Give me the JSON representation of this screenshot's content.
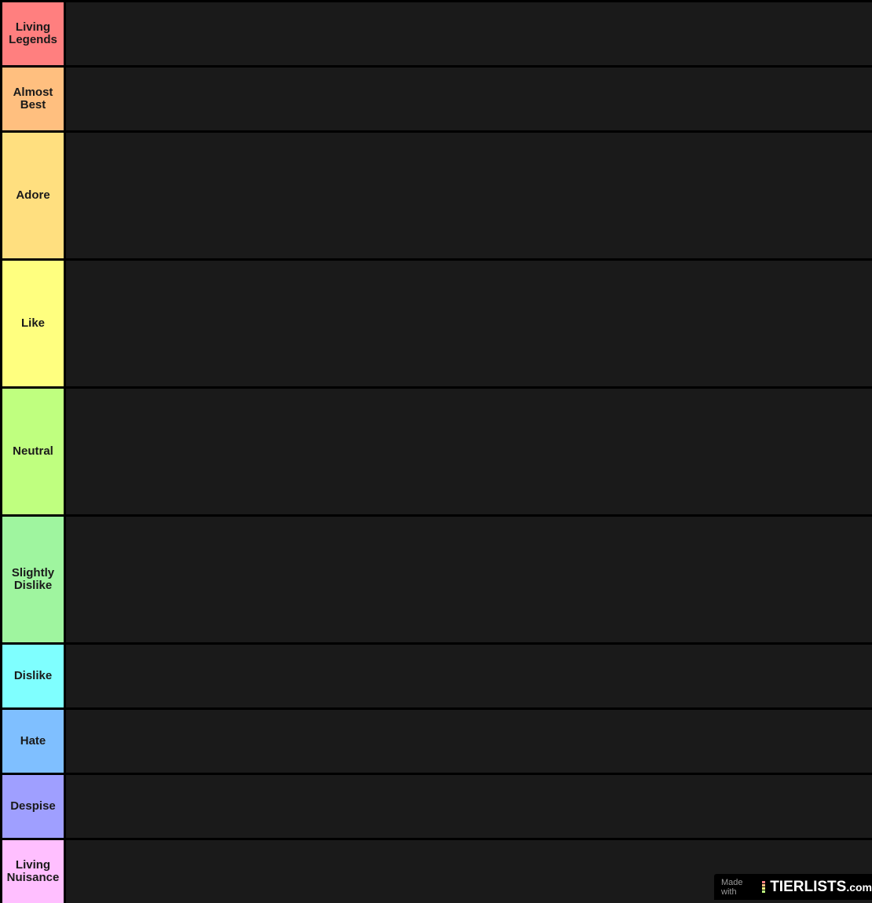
{
  "tiers": [
    {
      "label": "Living Legends",
      "color": "#ff7f7f"
    },
    {
      "label": "Almost Best",
      "color": "#ffbf7f"
    },
    {
      "label": "Adore",
      "color": "#ffdf7f"
    },
    {
      "label": "Like",
      "color": "#ffff7f"
    },
    {
      "label": "Neutral",
      "color": "#bfff7f"
    },
    {
      "label": "Slightly Dislike",
      "color": "#9ff59f"
    },
    {
      "label": "Dislike",
      "color": "#7fffff"
    },
    {
      "label": "Hate",
      "color": "#7fbfff"
    },
    {
      "label": "Despise",
      "color": "#9f9fff"
    },
    {
      "label": "Living Nuisance",
      "color": "#ffbfff"
    }
  ],
  "watermark": {
    "made_with": "Made with",
    "brand": "TIERLISTS",
    "suffix": ".com",
    "bar_colors": [
      "#ff7f7f",
      "#ffbf7f",
      "#ffff7f",
      "#bfff7f"
    ]
  }
}
